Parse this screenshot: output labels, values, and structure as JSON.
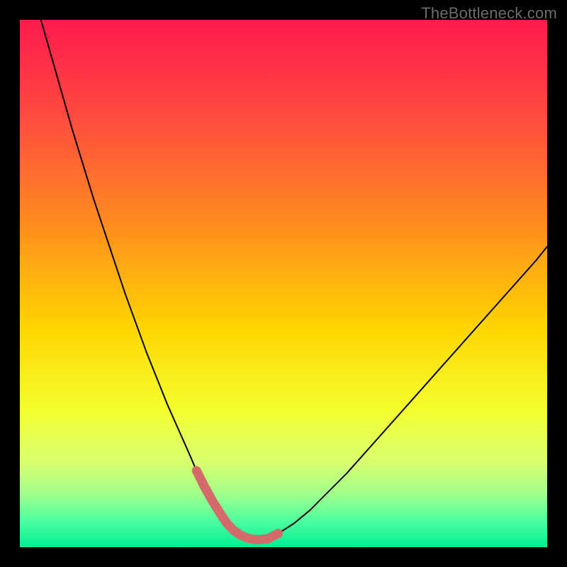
{
  "watermark": "TheBottleneck.com",
  "chart_data": {
    "type": "line",
    "title": "",
    "xlabel": "",
    "ylabel": "",
    "xlim": [
      0,
      100
    ],
    "ylim": [
      0,
      100
    ],
    "background_gradient": {
      "stops": [
        {
          "pct": 0,
          "color": "#ff1a4e"
        },
        {
          "pct": 18,
          "color": "#ff4a3f"
        },
        {
          "pct": 38,
          "color": "#ff8a20"
        },
        {
          "pct": 58,
          "color": "#ffd400"
        },
        {
          "pct": 74,
          "color": "#f4ff2e"
        },
        {
          "pct": 84,
          "color": "#d8ff70"
        },
        {
          "pct": 90,
          "color": "#9fff8c"
        },
        {
          "pct": 95,
          "color": "#4dffa0"
        },
        {
          "pct": 100,
          "color": "#00ef93"
        }
      ]
    },
    "series": [
      {
        "name": "curve",
        "color": "#000000",
        "stroke_width": 2,
        "x": [
          4,
          6,
          8,
          10,
          12,
          14,
          16,
          18,
          20,
          22,
          24,
          26,
          28,
          30,
          32,
          33.5,
          35,
          36.5,
          38,
          39.2,
          40.5,
          42,
          43.5,
          45,
          47,
          49,
          52,
          55,
          58,
          62,
          66,
          70,
          74,
          78,
          82,
          86,
          90,
          94,
          98,
          100
        ],
        "y": [
          100,
          93,
          86,
          79,
          72.5,
          66,
          60,
          54,
          48,
          42.5,
          37,
          32,
          27,
          22.5,
          18,
          14.5,
          11.5,
          8.8,
          6.4,
          4.6,
          3.2,
          2.2,
          1.6,
          1.4,
          1.6,
          2.6,
          4.5,
          7,
          10,
          14,
          18.5,
          23,
          27.5,
          32,
          36.5,
          41,
          45.5,
          50,
          54.5,
          57
        ]
      },
      {
        "name": "bottom-cap",
        "color": "#d46a6a",
        "stroke_width": 13,
        "x": [
          33.5,
          35,
          36.5,
          38,
          39.2,
          40.5,
          42,
          43.5,
          45,
          47,
          49
        ],
        "y": [
          14.5,
          11.5,
          8.8,
          6.4,
          4.6,
          3.2,
          2.2,
          1.6,
          1.4,
          1.6,
          2.6
        ]
      }
    ]
  }
}
